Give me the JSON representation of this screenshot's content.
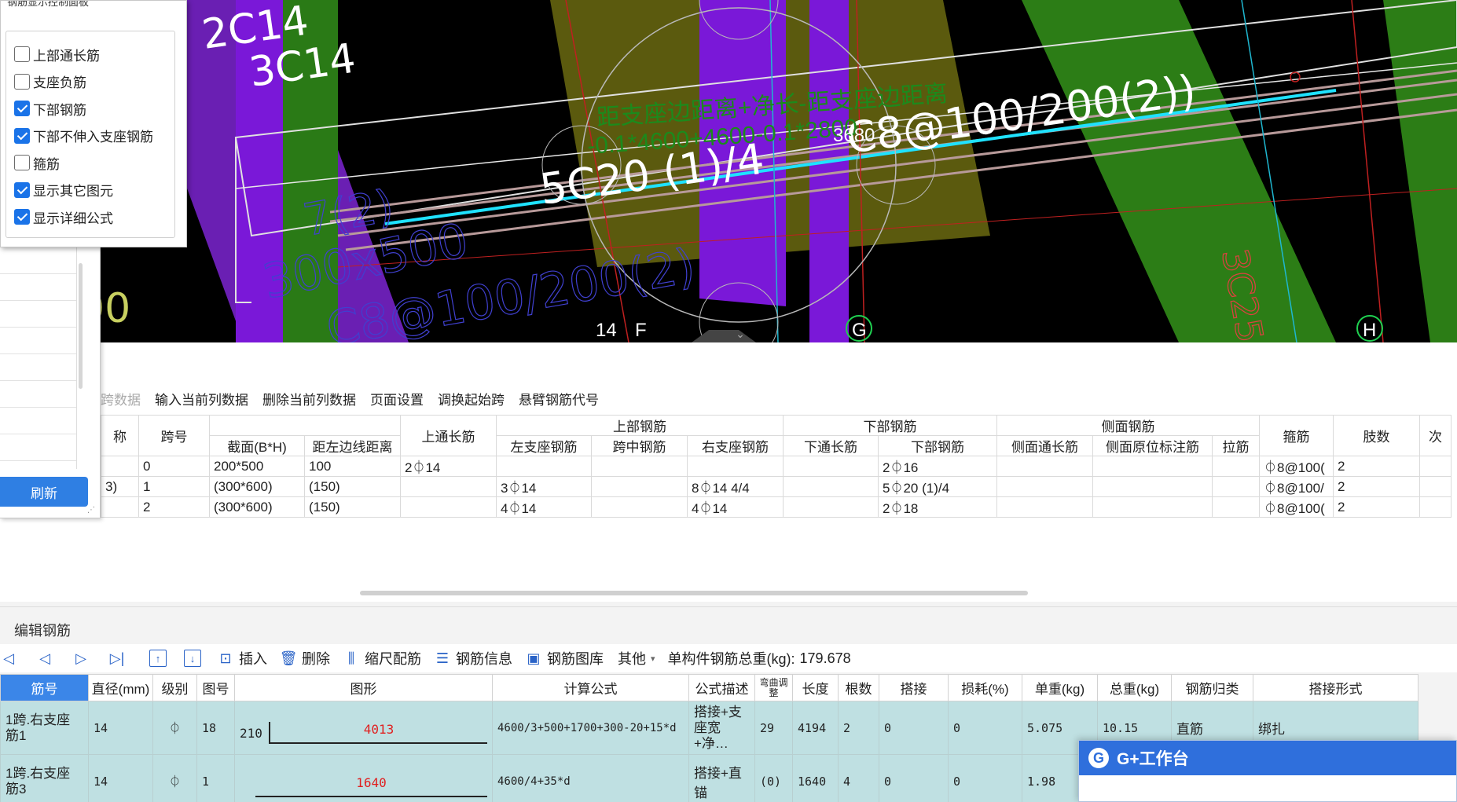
{
  "cad": {
    "labels_white": [
      "5C20 (1)/4",
      "C8@100/200(2))"
    ],
    "labels_green_top": [
      "2C14",
      "3C14"
    ],
    "formula_green_line1": "距支座边距离+净长-距支座边距离",
    "formula_green_line2": "-0.1*4600+4600-0.1*2800",
    "dim_3680": "3680",
    "axis_labels": [
      "14",
      "F",
      "G",
      "H"
    ],
    "label_3C25": "3C25",
    "label_dim_left": "300x500",
    "label_bottom": "C8@100/200(2)",
    "label_00": "00",
    "label_712": "7(2)"
  },
  "display_panel": {
    "title": "钢筋显示控制面板",
    "options": [
      {
        "label": "上部通长筋",
        "checked": false
      },
      {
        "label": "支座负筋",
        "checked": false
      },
      {
        "label": "下部钢筋",
        "checked": true
      },
      {
        "label": "下部不伸入支座钢筋",
        "checked": true
      },
      {
        "label": "箍筋",
        "checked": false
      },
      {
        "label": "显示其它图元",
        "checked": true
      },
      {
        "label": "显示详细公式",
        "checked": true
      }
    ]
  },
  "left_panel": {
    "refresh_label": "刷新"
  },
  "span_toolbar": {
    "items": [
      "跨数据",
      "输入当前列数据",
      "删除当前列数据",
      "页面设置",
      "调换起始跨",
      "悬臂钢筋代号"
    ]
  },
  "span_table": {
    "headers": {
      "name": "称",
      "span_no": "跨号",
      "section": "截面(B*H)",
      "offset": "距左边线距离",
      "top_long": "上通长筋",
      "top_group": "上部钢筋",
      "left_support": "左支座钢筋",
      "mid_span": "跨中钢筋",
      "right_support": "右支座钢筋",
      "bottom_group": "下部钢筋",
      "bottom_long": "下通长筋",
      "bottom_bar": "下部钢筋",
      "side_group": "侧面钢筋",
      "side_long": "侧面通长筋",
      "side_orig": "侧面原位标注筋",
      "tie": "拉筋",
      "stirrup": "箍筋",
      "legs": "肢数",
      "next": "次"
    },
    "rows": [
      {
        "name": "",
        "span": "0",
        "section": "200*500",
        "offset": "100",
        "top_long": "2⏀14",
        "left": "",
        "mid": "",
        "right": "",
        "bottom_long": "",
        "bottom": "2⏀16",
        "side_long": "",
        "side_orig": "",
        "tie": "",
        "stirrup": "⏀8@100(",
        "legs": "2"
      },
      {
        "name": "3)",
        "span": "1",
        "section": "(300*600)",
        "offset": "(150)",
        "top_long": "",
        "left": "3⏀14",
        "mid": "",
        "right": "8⏀14 4/4",
        "bottom_long": "",
        "bottom": "5⏀20 (1)/4",
        "side_long": "",
        "side_orig": "",
        "tie": "",
        "stirrup": "⏀8@100/",
        "legs": "2"
      },
      {
        "name": "",
        "span": "2",
        "section": "(300*600)",
        "offset": "(150)",
        "top_long": "",
        "left": "4⏀14",
        "mid": "",
        "right": "4⏀14",
        "bottom_long": "",
        "bottom": "2⏀18",
        "side_long": "",
        "side_orig": "",
        "tie": "",
        "stirrup": "⏀8@100(",
        "legs": "2"
      }
    ]
  },
  "edit_rebar": {
    "title": "编辑钢筋",
    "toolbar": {
      "insert": "插入",
      "delete": "删除",
      "scale_rebar": "缩尺配筋",
      "rebar_info": "钢筋信息",
      "rebar_library": "钢筋图库",
      "other": "其他",
      "total_weight_label": "单构件钢筋总重(kg):",
      "total_weight_value": "179.678"
    },
    "headers": [
      "筋号",
      "直径(mm)",
      "级别",
      "图号",
      "图形",
      "计算公式",
      "公式描述",
      "弯曲调整",
      "长度",
      "根数",
      "搭接",
      "损耗(%)",
      "单重(kg)",
      "总重(kg)",
      "钢筋归类",
      "搭接形式"
    ],
    "rows": [
      {
        "no": "1跨.右支座筋1",
        "dia": "14",
        "grade": "⏀",
        "fig": "18",
        "shape_left": "210",
        "shape_mid": "4013",
        "formula": "4600/3+500+1700+300-20+15*d",
        "desc": "搭接+支座宽+净…",
        "bend": "29",
        "length": "4194",
        "count": "2",
        "lap": "0",
        "loss": "0",
        "unit_w": "5.075",
        "total_w": "10.15",
        "category": "直筋",
        "lap_type": "绑扎"
      },
      {
        "no": "1跨.右支座筋3",
        "dia": "14",
        "grade": "⏀",
        "fig": "1",
        "shape_left": "",
        "shape_mid": "1640",
        "formula": "4600/4+35*d",
        "desc": "搭接+直锚",
        "bend": "(0)",
        "length": "1640",
        "count": "4",
        "lap": "0",
        "loss": "0",
        "unit_w": "1.98",
        "total_w": "",
        "category": "",
        "lap_type": ""
      }
    ]
  },
  "gplus": {
    "title": "G+工作台",
    "logo": "G"
  },
  "colors": {
    "accent": "#2f7fe3",
    "row_bg": "#bfe0e2",
    "cad_purple": "#7a18d8",
    "cad_green": "#2c7d16",
    "cad_olive": "#5b5a0e"
  }
}
